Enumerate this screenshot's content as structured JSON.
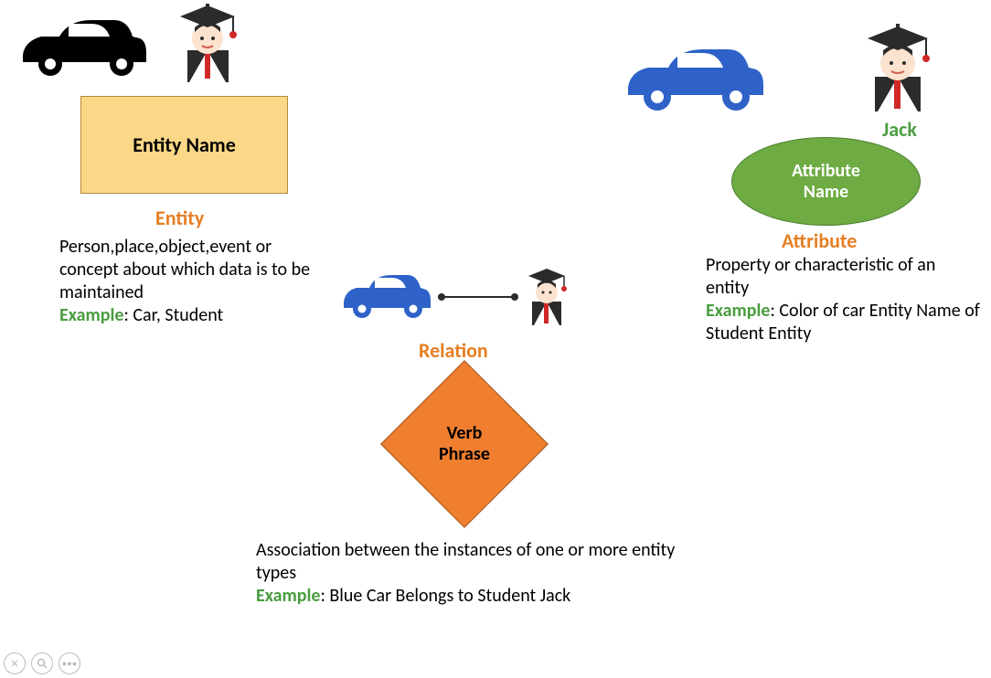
{
  "entity": {
    "box_label": "Entity Name",
    "title": "Entity",
    "desc": "Person,place,object,event or concept about which data is to be maintained",
    "example_prefix": "Example",
    "example_text": ": Car, Student"
  },
  "attribute": {
    "ellipse_label": "Attribute Name",
    "title": "Attribute",
    "student_name": "Jack",
    "desc": "Property or characteristic of an entity",
    "example_prefix": "Example",
    "example_text": ": Color of car Entity Name of Student Entity"
  },
  "relation": {
    "diamond_label": "Verb Phrase",
    "title": "Relation",
    "desc": "Association between the instances of one or more entity types",
    "example_prefix": "Example",
    "example_text": ": Blue Car Belongs to Student Jack"
  },
  "icons": {
    "car_black": "car-icon",
    "car_blue": "car-icon",
    "student": "student-icon"
  }
}
